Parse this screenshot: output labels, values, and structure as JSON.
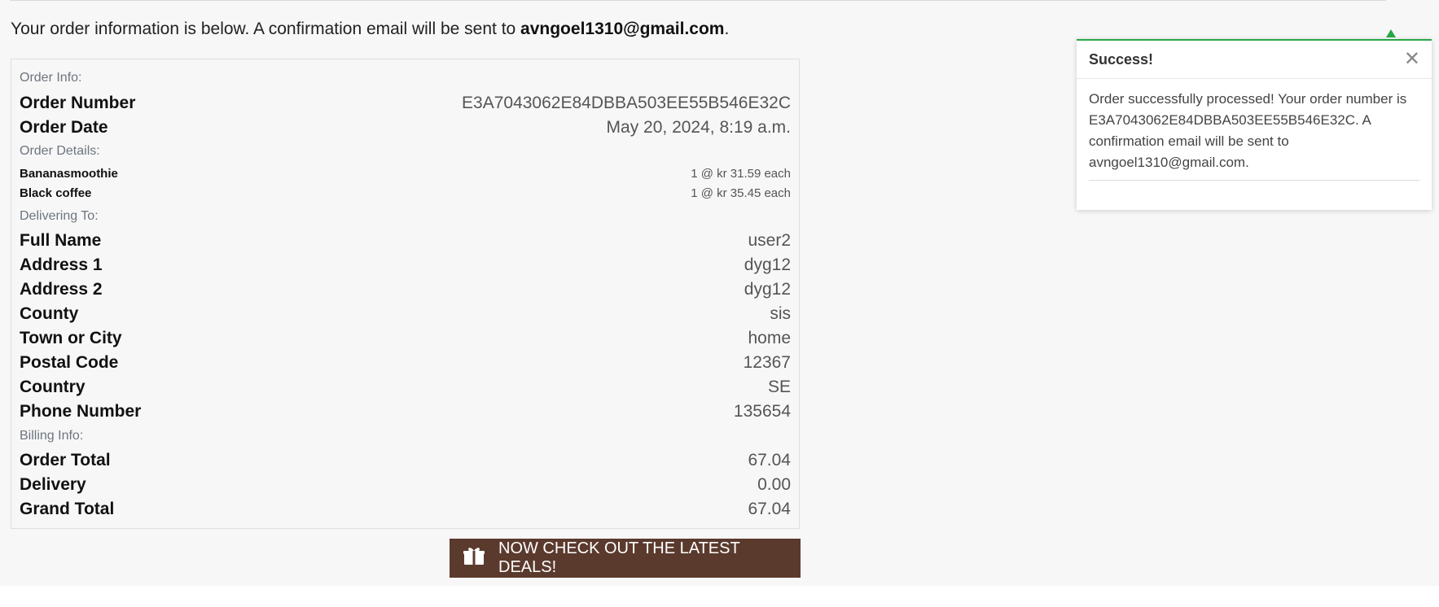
{
  "intro": {
    "text": "Your order information is below. A confirmation email will be sent to ",
    "email": "avngoel1310@gmail.com",
    "trailing": "."
  },
  "order_info": {
    "heading": "Order Info:",
    "order_number_label": "Order Number",
    "order_number": "E3A7043062E84DBBA503EE55B546E32C",
    "order_date_label": "Order Date",
    "order_date": "May 20, 2024, 8:19 a.m."
  },
  "order_details": {
    "heading": "Order Details:",
    "items": [
      {
        "name": "Bananasmoothie",
        "qty_price": "1 @ kr 31.59 each"
      },
      {
        "name": "Black coffee",
        "qty_price": "1 @ kr 35.45 each"
      }
    ]
  },
  "delivering_to": {
    "heading": "Delivering To:",
    "fields": [
      {
        "label": "Full Name",
        "value": "user2"
      },
      {
        "label": "Address 1",
        "value": "dyg12"
      },
      {
        "label": "Address 2",
        "value": "dyg12"
      },
      {
        "label": "County",
        "value": "sis"
      },
      {
        "label": "Town or City",
        "value": "home"
      },
      {
        "label": "Postal Code",
        "value": "12367"
      },
      {
        "label": "Country",
        "value": "SE"
      },
      {
        "label": "Phone Number",
        "value": "135654"
      }
    ]
  },
  "billing_info": {
    "heading": "Billing Info:",
    "fields": [
      {
        "label": "Order Total",
        "value": "67.04"
      },
      {
        "label": "Delivery",
        "value": "0.00"
      },
      {
        "label": "Grand Total",
        "value": "67.04"
      }
    ]
  },
  "deals_button": {
    "label": "NOW CHECK OUT THE LATEST DEALS!",
    "icon": "gift-icon",
    "color": "#5b3a2e"
  },
  "toast": {
    "title": "Success!",
    "close_symbol": "✕",
    "message": "Order successfully processed! Your order number is E3A7043062E84DBBA503EE55B546E32C. A confirmation email will be sent to avngoel1310@gmail.com.",
    "accent_color": "#28a745"
  }
}
